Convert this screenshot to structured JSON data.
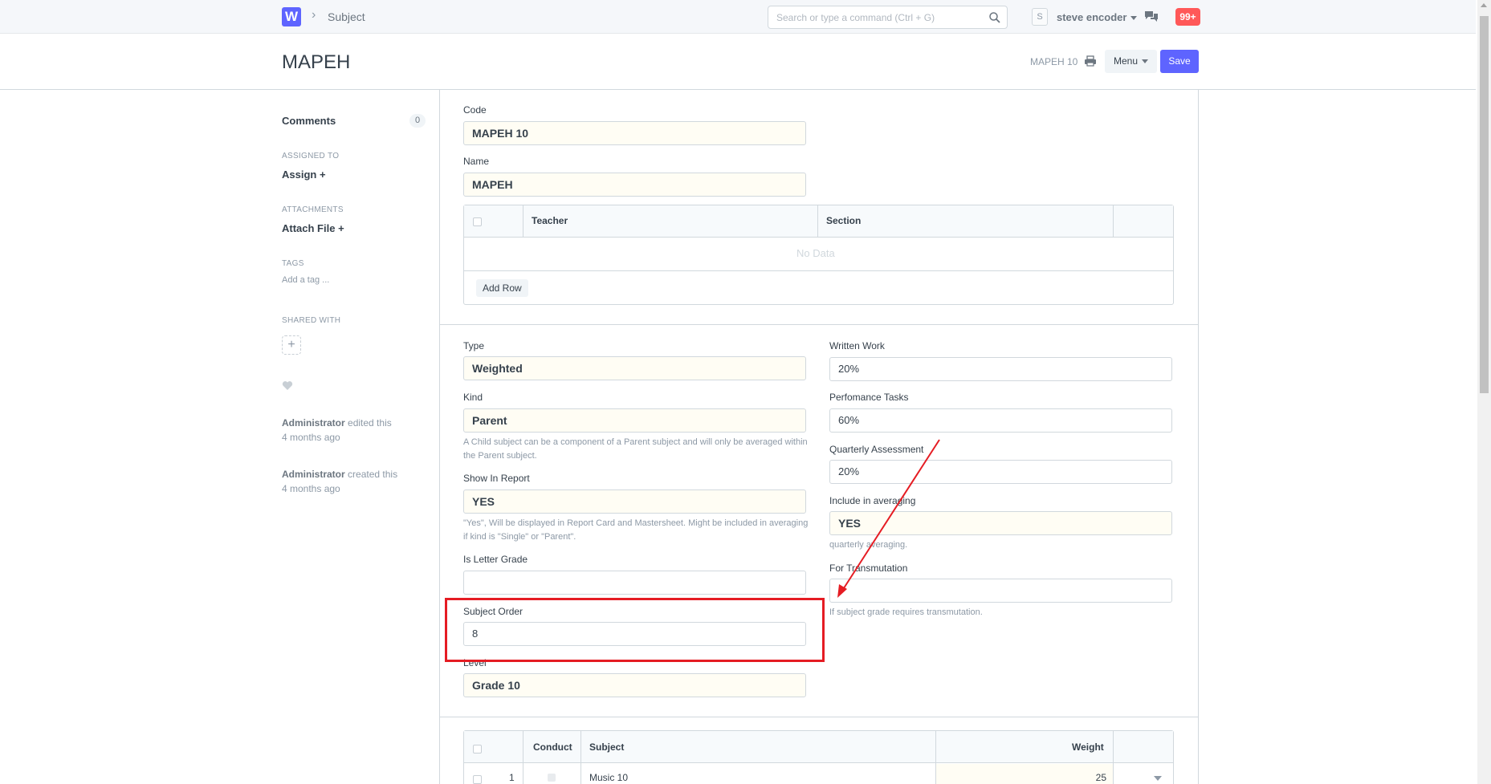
{
  "nav": {
    "logo": "W",
    "breadcrumb": "Subject",
    "search_placeholder": "Search or type a command (Ctrl + G)",
    "avatar_initial": "S",
    "username": "steve encoder",
    "notifications": "99+"
  },
  "header": {
    "title": "MAPEH",
    "doc_name": "MAPEH 10",
    "menu_label": "Menu",
    "save_label": "Save"
  },
  "sidebar": {
    "comments_label": "Comments",
    "comments_count": "0",
    "assigned_heading": "ASSIGNED TO",
    "assign_label": "Assign",
    "attachments_heading": "ATTACHMENTS",
    "attach_label": "Attach File",
    "tags_heading": "TAGS",
    "tag_placeholder": "Add a tag ...",
    "shared_heading": "SHARED WITH",
    "activity": [
      {
        "user": "Administrator",
        "action": "edited this",
        "time": "4 months ago"
      },
      {
        "user": "Administrator",
        "action": "created this",
        "time": "4 months ago"
      }
    ]
  },
  "form": {
    "code": {
      "label": "Code",
      "value": "MAPEH 10"
    },
    "name": {
      "label": "Name",
      "value": "MAPEH"
    },
    "teachers_grid": {
      "headers": [
        "Teacher",
        "Section"
      ],
      "empty_text": "No Data",
      "add_row": "Add Row"
    },
    "type": {
      "label": "Type",
      "value": "Weighted"
    },
    "kind": {
      "label": "Kind",
      "value": "Parent",
      "help": "A Child subject can be a component of a Parent subject and will only be averaged within the Parent subject."
    },
    "show_in_report": {
      "label": "Show In Report",
      "value": "YES",
      "help": "\"Yes\", Will be displayed in Report Card and Mastersheet. Might be included in averaging if kind is \"Single\" or \"Parent\"."
    },
    "is_letter_grade": {
      "label": "Is Letter Grade",
      "value": ""
    },
    "subject_order": {
      "label": "Subject Order",
      "value": "8"
    },
    "level": {
      "label": "Level",
      "value": "Grade 10"
    },
    "written_work": {
      "label": "Written Work",
      "value": "20%"
    },
    "performance_tasks": {
      "label": "Perfomance Tasks",
      "value": "60%"
    },
    "quarterly_assessment": {
      "label": "Quarterly Assessment",
      "value": "20%"
    },
    "include_in_averaging": {
      "label": "Include in averaging",
      "value": "YES",
      "help": "quarterly averaging."
    },
    "for_transmutation": {
      "label": "For Transmutation",
      "value": "",
      "help": "If subject grade requires transmutation."
    },
    "components_grid": {
      "headers": [
        "Conduct",
        "Subject",
        "Weight"
      ],
      "rows": [
        {
          "idx": "1",
          "subject": "Music 10",
          "weight": "25"
        }
      ]
    }
  },
  "colors": {
    "accent": "#5e64ff",
    "annotation": "#e51c23",
    "required_bg": "#fffdf4"
  }
}
